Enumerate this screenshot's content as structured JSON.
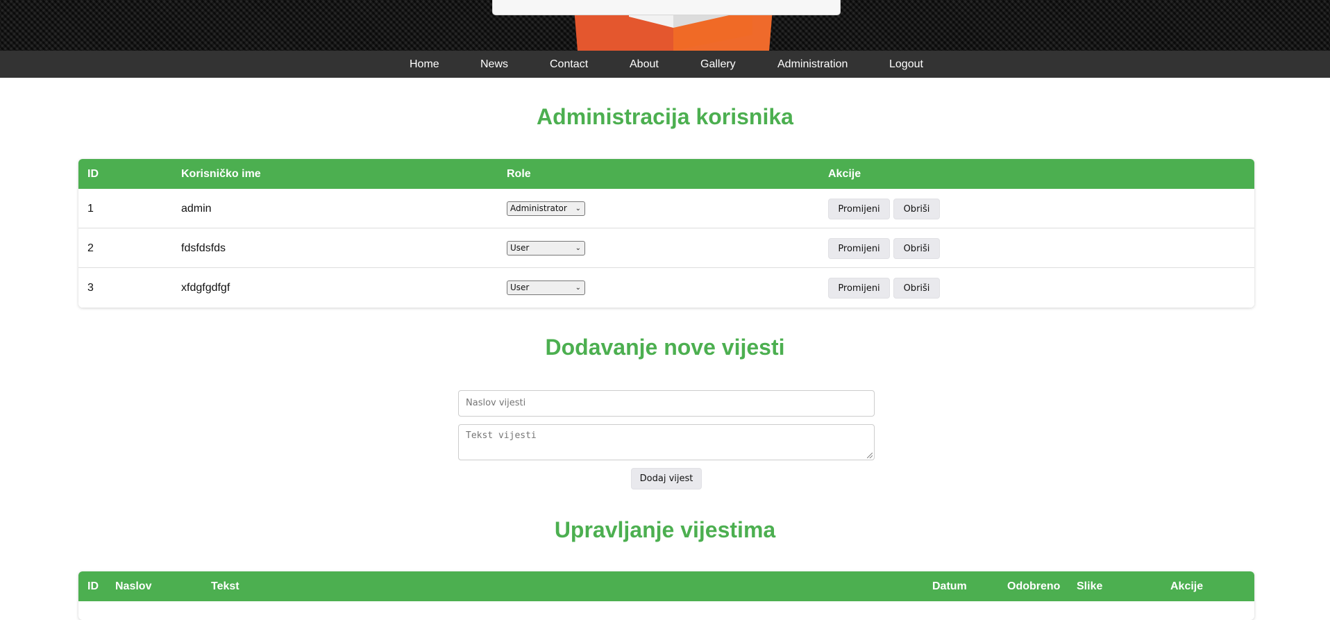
{
  "nav": {
    "items": [
      "Home",
      "News",
      "Contact",
      "About",
      "Gallery",
      "Administration",
      "Logout"
    ]
  },
  "users_section": {
    "title": "Administracija korisnika",
    "columns": [
      "ID",
      "Korisničko ime",
      "Role",
      "Akcije"
    ],
    "rows": [
      {
        "id": "1",
        "username": "admin",
        "role": "Administrator",
        "change_label": "Promijeni",
        "delete_label": "Obriši"
      },
      {
        "id": "2",
        "username": "fdsfdsfds",
        "role": "User",
        "change_label": "Promijeni",
        "delete_label": "Obriši"
      },
      {
        "id": "3",
        "username": "xfdgfgdfgf",
        "role": "User",
        "change_label": "Promijeni",
        "delete_label": "Obriši"
      }
    ]
  },
  "add_news": {
    "title": "Dodavanje nove vijesti",
    "title_placeholder": "Naslov vijesti",
    "text_placeholder": "Tekst vijesti",
    "submit_label": "Dodaj vijest"
  },
  "news_section": {
    "title": "Upravljanje vijestima",
    "columns": [
      "ID",
      "Naslov",
      "Tekst",
      "Datum",
      "Odobreno",
      "Slike",
      "Akcije"
    ]
  },
  "colors": {
    "accent": "#4caf50",
    "nav_bg": "#333333",
    "logo_orange": "#e4572e"
  },
  "icons": {
    "select_arrow": "chevron-down-icon",
    "logo": "logo-shield"
  }
}
